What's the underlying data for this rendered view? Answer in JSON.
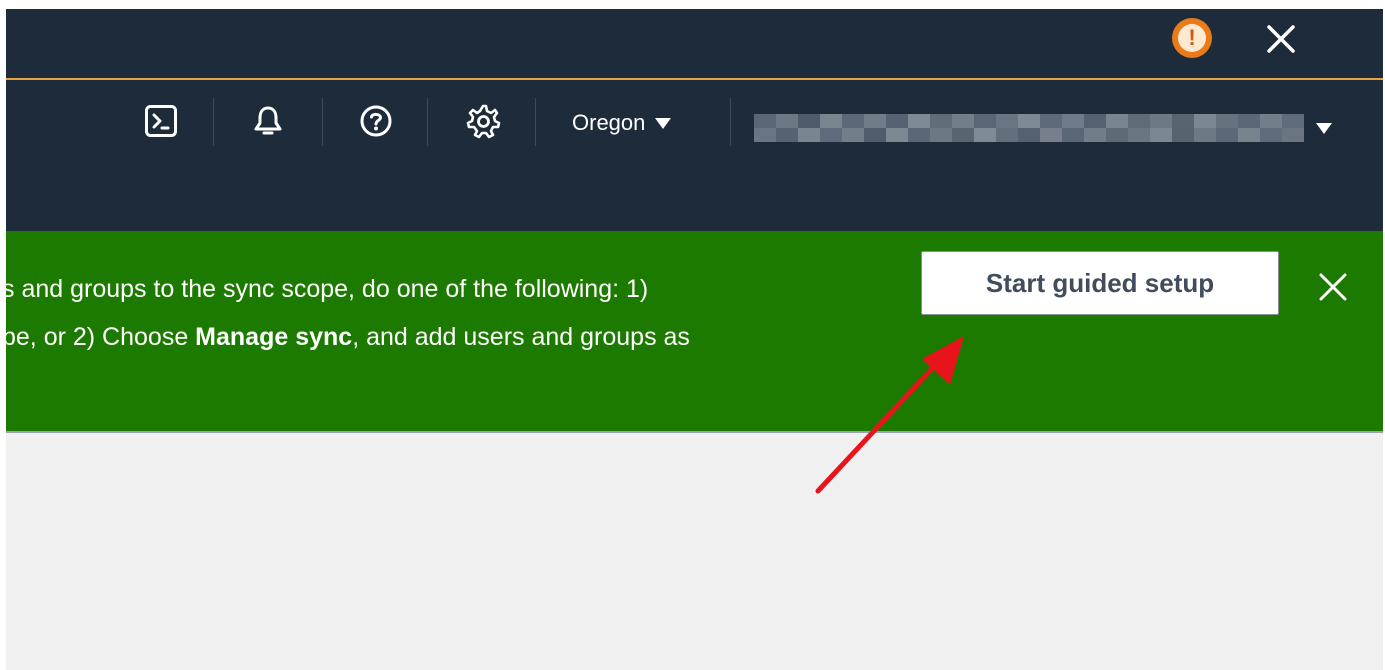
{
  "header": {
    "alert_icon": "alert-icon",
    "alert_glyph": "!",
    "close_icon": "close-icon"
  },
  "nav": {
    "cloudshell_icon": "terminal-icon",
    "notifications_icon": "bell-icon",
    "help_icon": "help-icon",
    "settings_icon": "gear-icon",
    "region_label": "Oregon",
    "account_icon": "caret-down-icon"
  },
  "banner": {
    "line1": "s and groups to the sync scope, do one of the following: 1)",
    "line2_before": "pe, or 2) Choose ",
    "line2_bold": "Manage sync",
    "line2_after": ", and add users and groups as",
    "button_label": "Start guided setup",
    "close_icon": "close-icon",
    "color": "#1d7a00"
  },
  "annotation": {
    "arrow_color": "#e8141b"
  },
  "colors": {
    "header_bg": "#1e2b3b",
    "accent": "#e8a341"
  }
}
